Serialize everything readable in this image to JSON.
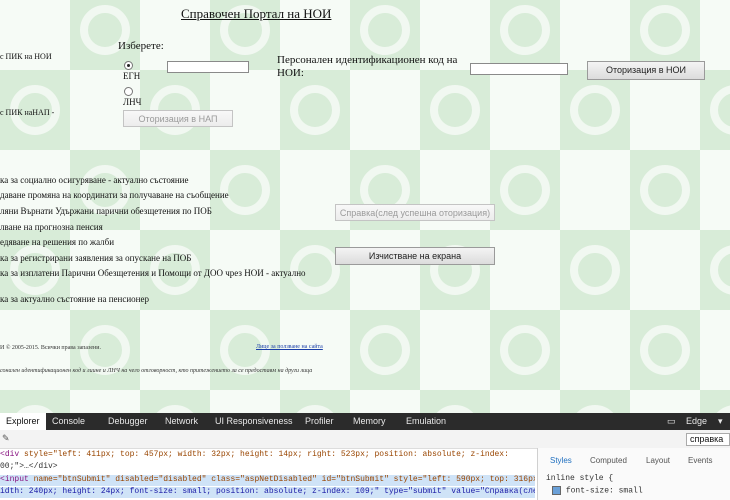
{
  "page": {
    "title": "Справочен Портал на НОИ",
    "choose_label": "Изберете:",
    "radio_egn": "ЕГН",
    "radio_lnch": "ЛНЧ",
    "pik_label": "Персонален идентификационен код на НОИ:",
    "left_label_1": "с ПИК на НОИ",
    "left_label_2": "с ПИК наНАП -",
    "btn_auth_nap": "Оторизация в НАП",
    "btn_auth_noi": "Оторизация в НОИ",
    "services": [
      "ка за социално осигуряване - актуално състояние",
      "даване промяна на координати за получаване на съобщение",
      "ляни Върнати Удържани парични обезщетения по ПОБ",
      "лване на прогнозна пенсия",
      "едяване на решения по жалби",
      "ка за регистрирани заявления за опускане на ПОБ",
      "ка за изплатени Парични Обезщетения и Помощи от ДОО чрез НОИ - актуално",
      "ка за актуално състояние на пенсионер"
    ],
    "btn_spravka": "Справка(след успешна оторизация)",
    "btn_clear": "Изчистване на екрана",
    "copyright": "И © 2005-2015. Всички права запазени.",
    "terms_link": "Лице за ползване на сайта",
    "footer_note": "сонален идентификационен код и лиине и ЛНЧ на чего отговорност, кто притежението за се предоставм на други лица"
  },
  "devtools": {
    "tabs": [
      "Explorer",
      "Console",
      "Debugger",
      "Network",
      "UI Responsiveness",
      "Profiler",
      "Memory",
      "Emulation"
    ],
    "mode_label": "Edge",
    "search_value": "справка",
    "code_lines": [
      {
        "pre": "div ",
        "attrs": "style=\"left: 411px; top: 457px; width: 32px; height: 14px; right: 523px; position: absolute; z-index:"
      },
      {
        "pre": "00;\">…</div>",
        "attrs": ""
      },
      {
        "pre": "input ",
        "attrs": "name=\"btnSubmit\" disabled=\"disabled\" class=\"aspNetDisabled\" id=\"btnSubmit\" style=\"left: 590px; top: 316px;"
      },
      {
        "pre": "idth: 240px; height: 24px; font-size: small; position: absolute; z-index: 109;\" type=\"submit\" value=\"Справка(след",
        "attrs": ""
      }
    ],
    "panel_tabs": [
      "Styles",
      "Computed",
      "Layout",
      "Events"
    ],
    "style_rule": "inline style  {",
    "style_prop": "font-size: small"
  }
}
